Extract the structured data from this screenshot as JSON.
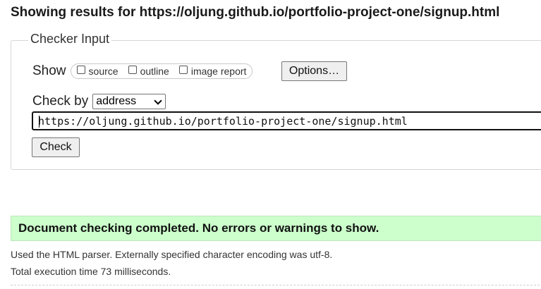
{
  "heading": "Showing results for https://oljung.github.io/portfolio-project-one/signup.html",
  "checker": {
    "legend": "Checker Input",
    "show_label": "Show",
    "options": [
      {
        "label": "source",
        "checked": false
      },
      {
        "label": "outline",
        "checked": false
      },
      {
        "label": "image report",
        "checked": false
      }
    ],
    "options_button": "Options…",
    "check_by_label": "Check by",
    "check_by_value": "address",
    "url_value": "https://oljung.github.io/portfolio-project-one/signup.html",
    "check_button": "Check"
  },
  "result": {
    "message": "Document checking completed. No errors or warnings to show.",
    "color": "#ccffcc"
  },
  "info": {
    "parser": "Used the HTML parser. Externally specified character encoding was utf-8.",
    "time": "Total execution time 73 milliseconds."
  }
}
